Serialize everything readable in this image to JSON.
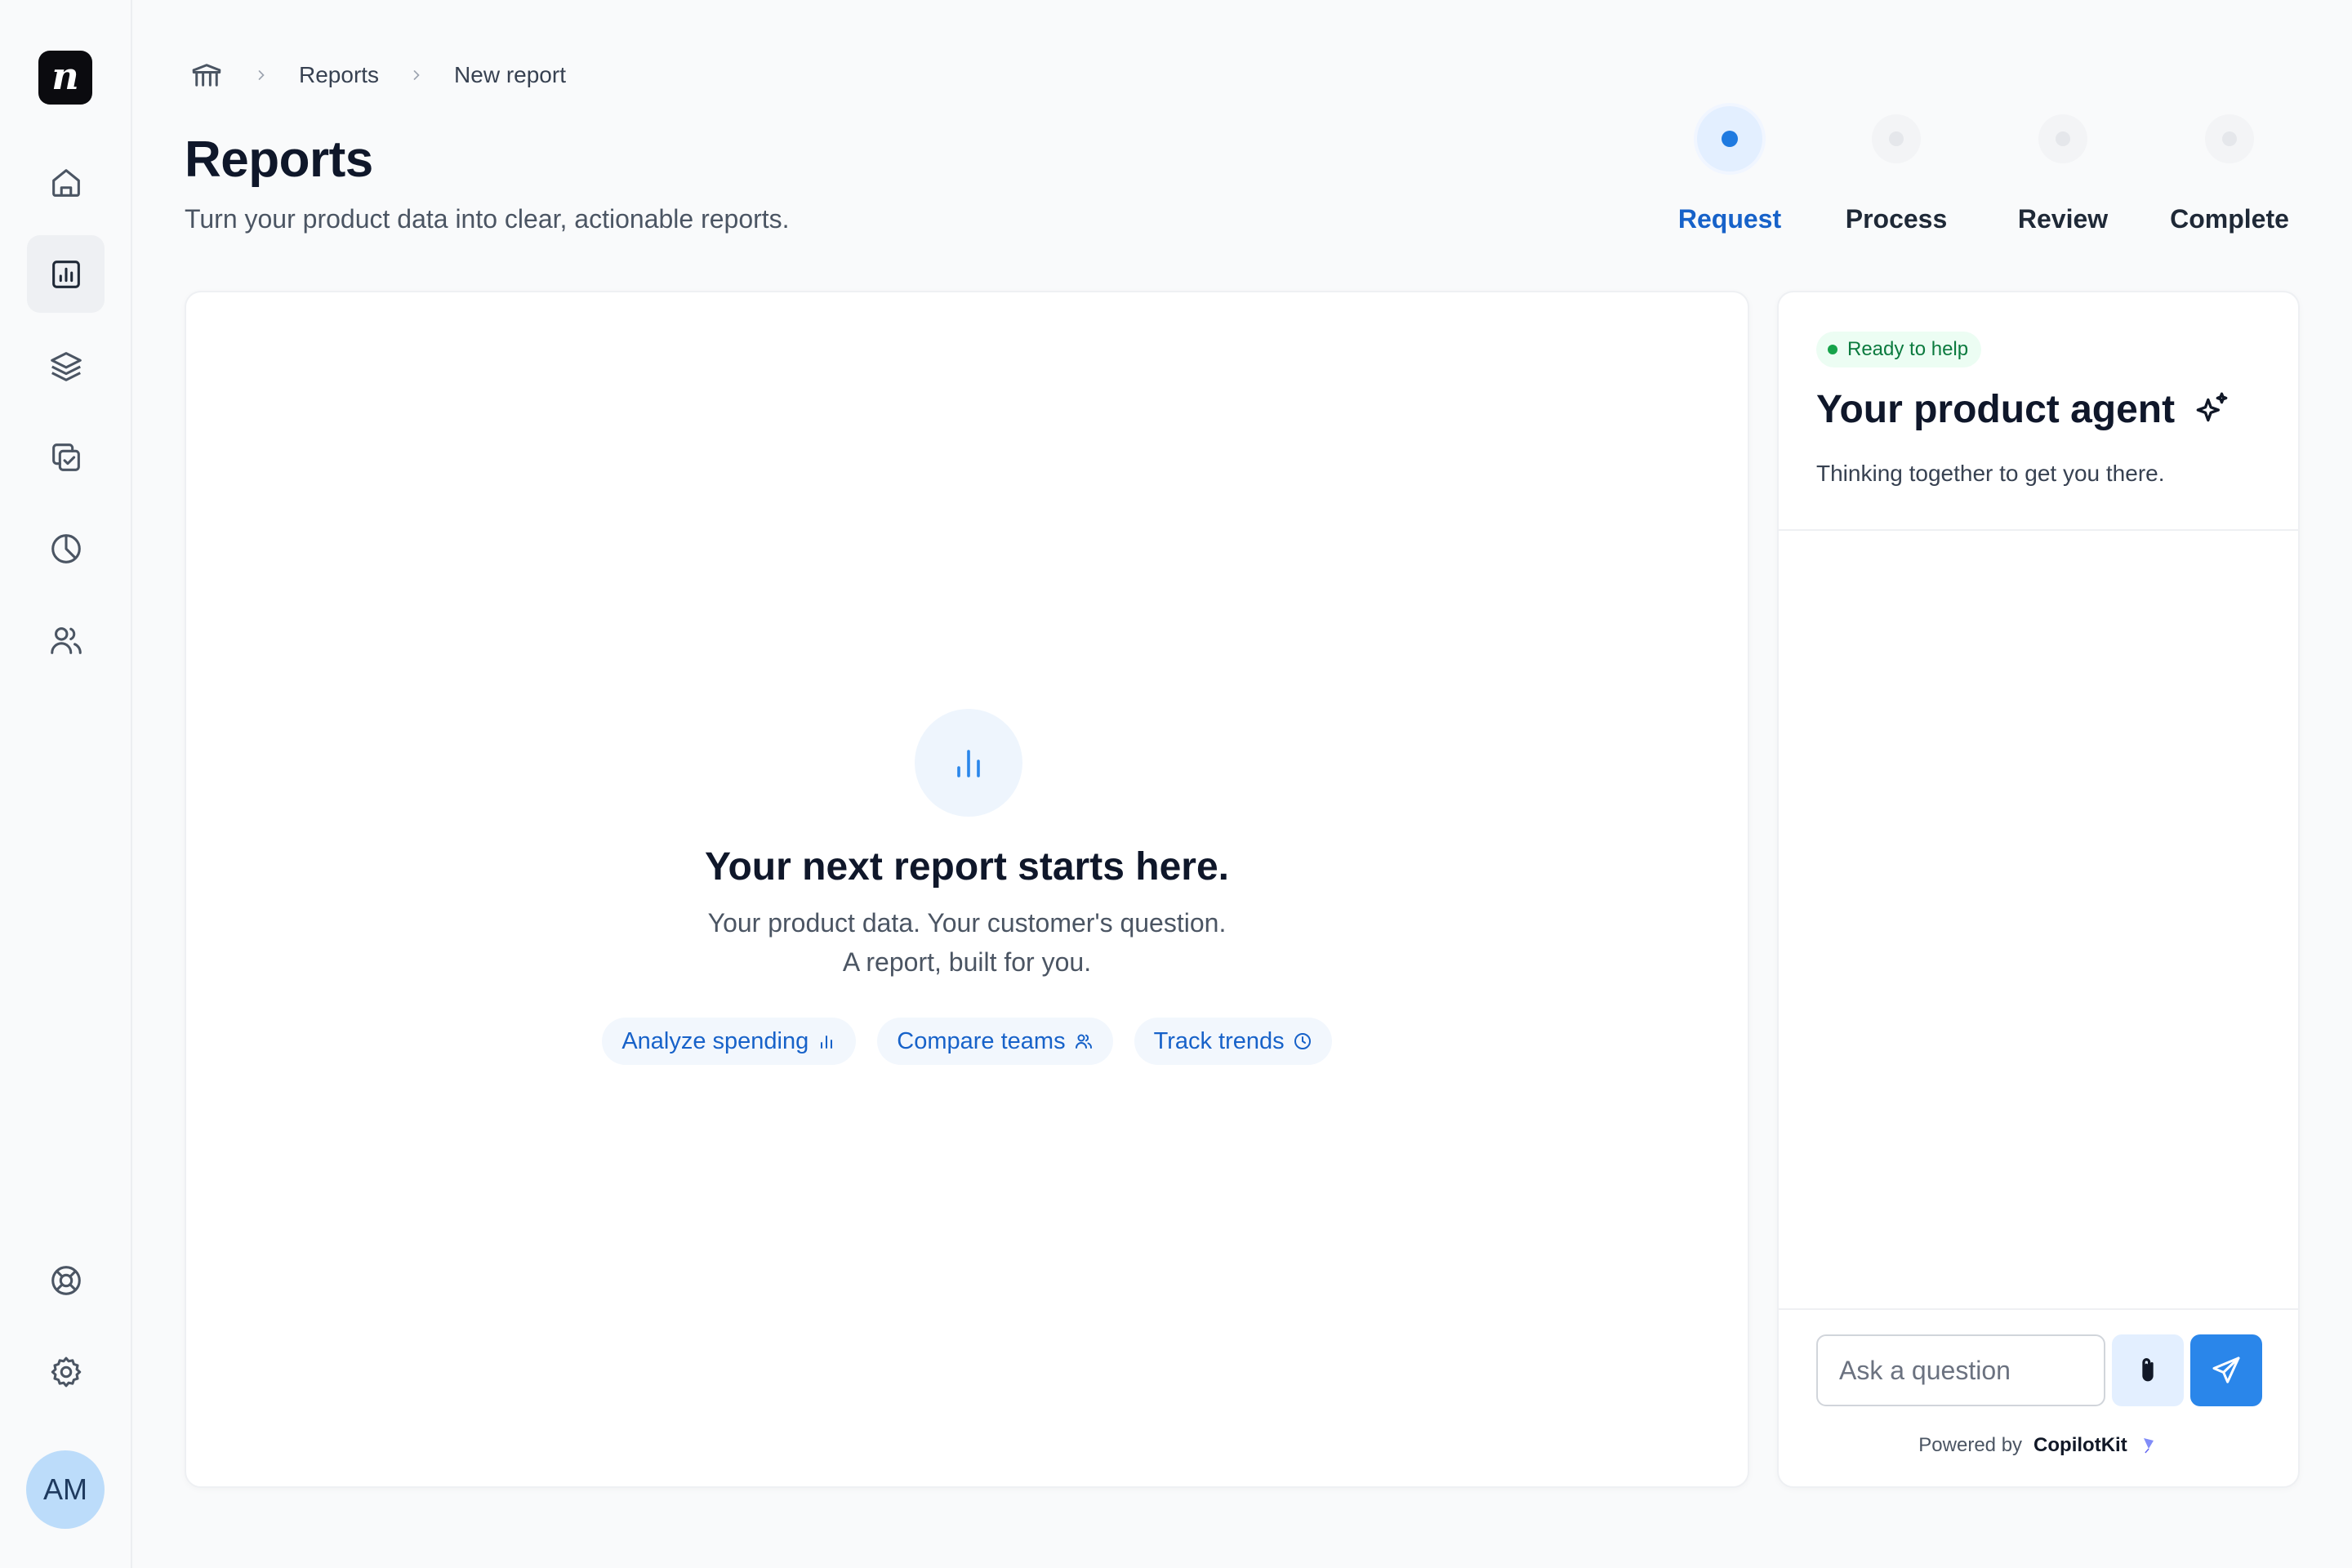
{
  "app": {
    "logo_letter": "n"
  },
  "sidebar": {
    "items": [
      {
        "name": "home",
        "icon": "home-icon"
      },
      {
        "name": "reports",
        "icon": "bar-chart-icon",
        "active": true
      },
      {
        "name": "layers",
        "icon": "layers-icon"
      },
      {
        "name": "tasks",
        "icon": "copy-check-icon"
      },
      {
        "name": "analytics",
        "icon": "pie-chart-icon"
      },
      {
        "name": "users",
        "icon": "users-icon"
      }
    ],
    "bottom": [
      {
        "name": "help",
        "icon": "life-buoy-icon"
      },
      {
        "name": "settings",
        "icon": "gear-icon"
      }
    ],
    "avatar_initials": "AM"
  },
  "breadcrumb": {
    "items": [
      "Reports",
      "New report"
    ]
  },
  "header": {
    "title": "Reports",
    "subtitle": "Turn your product data into clear, actionable reports."
  },
  "stepper": {
    "steps": [
      {
        "label": "Request",
        "active": true
      },
      {
        "label": "Process",
        "active": false
      },
      {
        "label": "Review",
        "active": false
      },
      {
        "label": "Complete",
        "active": false
      }
    ]
  },
  "empty_state": {
    "title": "Your next report starts here.",
    "line1": "Your product data. Your customer's question.",
    "line2": "A report, built for you.",
    "chips": [
      {
        "label": "Analyze spending",
        "icon": "bar-chart-icon"
      },
      {
        "label": "Compare teams",
        "icon": "users-icon"
      },
      {
        "label": "Track trends",
        "icon": "clock-icon"
      }
    ]
  },
  "agent": {
    "status": "Ready to help",
    "title": "Your product agent",
    "subtitle": "Thinking together to get you there.",
    "input_placeholder": "Ask a question",
    "powered_by": "Powered by",
    "brand": "CopilotKit"
  },
  "colors": {
    "accent": "#1762c9",
    "primary_button": "#2a86ea",
    "status_green": "#16a34a",
    "background": "#f9fafb"
  }
}
